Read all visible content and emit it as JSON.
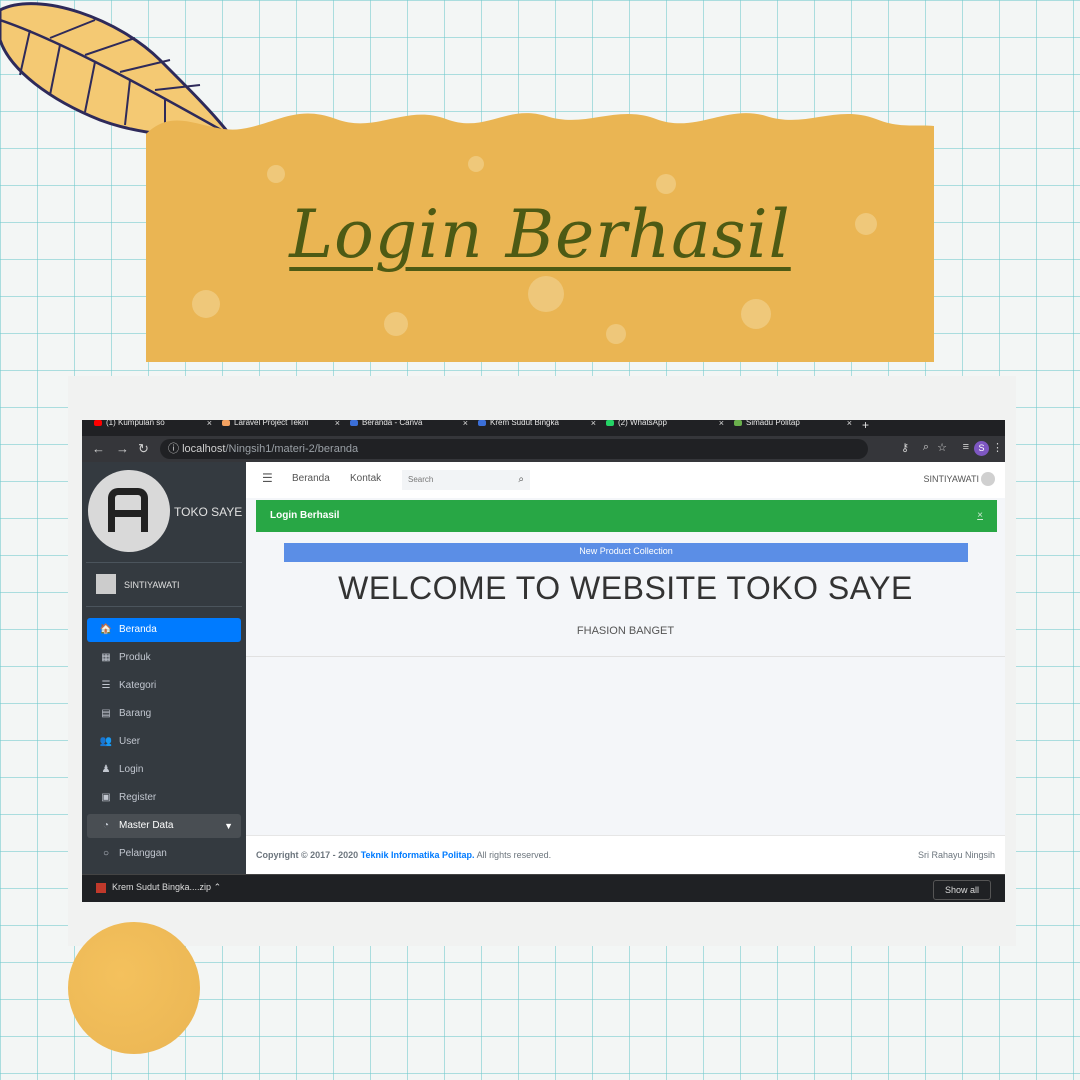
{
  "banner": {
    "title": "Login Berhasil"
  },
  "browser": {
    "tabs": [
      {
        "label": "(1) Kumpulan so",
        "color": "#ff0000"
      },
      {
        "label": "Laravel Project Tekni",
        "color": "#f4a261"
      },
      {
        "label": "Beranda - Canva",
        "color": "#3b6fd8"
      },
      {
        "label": "Krem Sudut Bingka",
        "color": "#3b6fd8"
      },
      {
        "label": "(2) WhatsApp",
        "color": "#25d366"
      },
      {
        "label": "Simadu Politap",
        "color": "#6ab04c"
      }
    ],
    "url_host": "localhost",
    "url_path": "/Ningsih1/materi-2/beranda",
    "profile_initial": "S"
  },
  "sidebar": {
    "brand": "TOKO SAYE",
    "user": "SINTIYAWATI",
    "items": [
      {
        "label": "Beranda",
        "icon": "home-icon",
        "glyph": "🏠",
        "active": true
      },
      {
        "label": "Produk",
        "icon": "grid-icon",
        "glyph": "▦"
      },
      {
        "label": "Kategori",
        "icon": "list-icon",
        "glyph": "☰"
      },
      {
        "label": "Barang",
        "icon": "archive-icon",
        "glyph": "▤"
      },
      {
        "label": "User",
        "icon": "users-icon",
        "glyph": "👥"
      },
      {
        "label": "Login",
        "icon": "user-tie-icon",
        "glyph": "♟"
      },
      {
        "label": "Register",
        "icon": "id-card-icon",
        "glyph": "▣"
      },
      {
        "label": "Master Data",
        "icon": "dashboard-icon",
        "glyph": "◔",
        "group": true
      },
      {
        "label": "Pelanggan",
        "icon": "circle-icon",
        "glyph": "○"
      }
    ]
  },
  "topnav": {
    "links": [
      "Beranda",
      "Kontak"
    ],
    "search_placeholder": "Search",
    "user": "SINTIYAWATI"
  },
  "content": {
    "alert": "Login Berhasil",
    "alert_close": "×",
    "promo": "New Product Collection",
    "welcome": "WELCOME TO WEBSITE TOKO SAYE",
    "subtitle": "FHASION BANGET"
  },
  "footer": {
    "copyright": "Copyright © 2017 - 2020",
    "org": "Teknik Informatika Politap.",
    "rights": "All rights reserved.",
    "author": "Sri Rahayu Ningsih"
  },
  "download": {
    "file": "Krem Sudut Bingka....zip",
    "show_all": "Show all"
  },
  "colors": {
    "banner": "#eab553",
    "title": "#4d5a14",
    "sidebar": "#343a40",
    "active": "#007bff",
    "alert": "#28a745"
  }
}
